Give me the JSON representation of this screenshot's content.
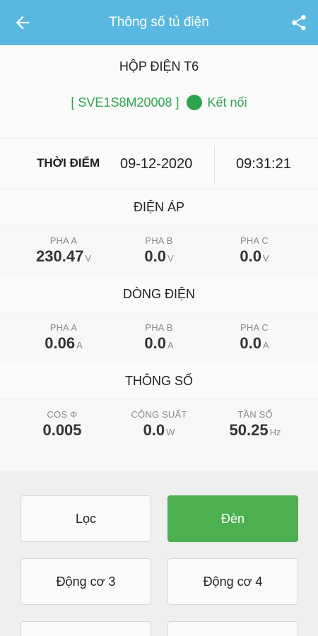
{
  "header": {
    "title": "Thông số tủ điện",
    "back_icon": "arrow-left-icon",
    "share_icon": "share-icon"
  },
  "device": {
    "name": "HỘP ĐIỆN T6",
    "code": "[ SVE1S8M20008 ]",
    "status": "Kết nối",
    "status_color": "#2ea44f"
  },
  "time": {
    "label": "THỜI ĐIỂM",
    "date": "09-12-2020",
    "clock": "09:31:21"
  },
  "voltage": {
    "title": "ĐIỆN ÁP",
    "cells": [
      {
        "label": "PHA A",
        "value": "230.47",
        "unit": "V"
      },
      {
        "label": "PHA B",
        "value": "0.0",
        "unit": "V"
      },
      {
        "label": "PHA C",
        "value": "0.0",
        "unit": "V"
      }
    ]
  },
  "current": {
    "title": "DÒNG ĐIỆN",
    "cells": [
      {
        "label": "PHA A",
        "value": "0.06",
        "unit": "A"
      },
      {
        "label": "PHA B",
        "value": "0.0",
        "unit": "A"
      },
      {
        "label": "PHA C",
        "value": "0.0",
        "unit": "A"
      }
    ]
  },
  "params": {
    "title": "THÔNG SỐ",
    "cells": [
      {
        "label": "COS Φ",
        "value": "0.005",
        "unit": ""
      },
      {
        "label": "CÔNG SUẤT",
        "value": "0.0",
        "unit": "W"
      },
      {
        "label": "TẦN SỐ",
        "value": "50.25",
        "unit": "Hz"
      }
    ]
  },
  "controls": {
    "buttons": [
      {
        "label": "Lọc",
        "active": false
      },
      {
        "label": "Đèn",
        "active": true
      },
      {
        "label": "Động cơ 3",
        "active": false
      },
      {
        "label": "Động cơ 4",
        "active": false
      }
    ],
    "active_color": "#4caf50"
  }
}
